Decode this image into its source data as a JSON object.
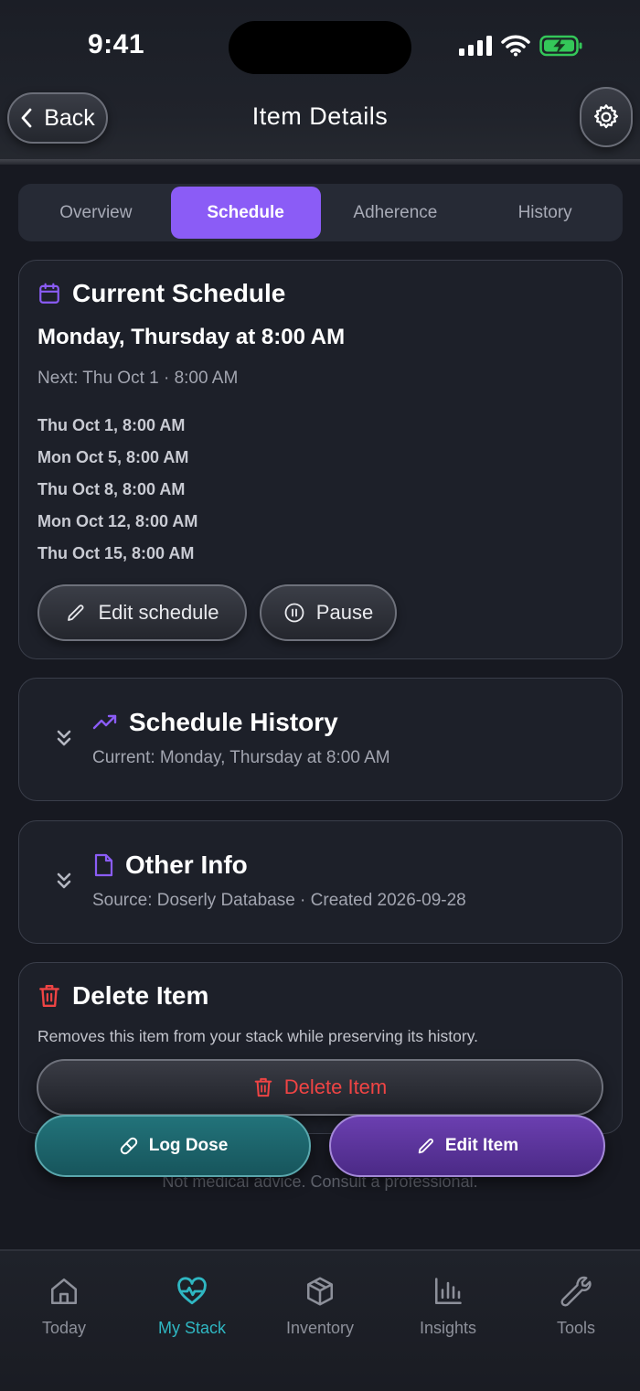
{
  "status_bar": {
    "time": "9:41"
  },
  "header": {
    "back_label": "Back",
    "title": "Item Details"
  },
  "tabs": [
    {
      "label": "Overview",
      "active": false
    },
    {
      "label": "Schedule",
      "active": true
    },
    {
      "label": "Adherence",
      "active": false
    },
    {
      "label": "History",
      "active": false
    }
  ],
  "current_schedule": {
    "title": "Current Schedule",
    "schedule_text": "Monday, Thursday at 8:00 AM",
    "next_text": "Next: Thu Oct 1 · 8:00 AM",
    "upcoming": [
      "Thu Oct 1, 8:00 AM",
      "Mon Oct 5, 8:00 AM",
      "Thu Oct 8, 8:00 AM",
      "Mon Oct 12, 8:00 AM",
      "Thu Oct 15, 8:00 AM"
    ],
    "edit_label": "Edit schedule",
    "pause_label": "Pause"
  },
  "schedule_history": {
    "title": "Schedule History",
    "subtitle": "Current: Monday, Thursday at 8:00 AM"
  },
  "other_info": {
    "title": "Other Info",
    "subtitle": "Source: Doserly Database · Created 2026-09-28"
  },
  "delete_item": {
    "title": "Delete Item",
    "description": "Removes this item from your stack while preserving its history.",
    "button_label": "Delete Item"
  },
  "actions": {
    "log_label": "Log Dose",
    "edit_label": "Edit Item"
  },
  "disclaimer": "Not medical advice. Consult a professional.",
  "bottom_nav": [
    {
      "label": "Today",
      "icon": "home-icon",
      "active": false
    },
    {
      "label": "My Stack",
      "icon": "heart-pulse-icon",
      "active": true
    },
    {
      "label": "Inventory",
      "icon": "box-icon",
      "active": false
    },
    {
      "label": "Insights",
      "icon": "bar-chart-icon",
      "active": false
    },
    {
      "label": "Tools",
      "icon": "wrench-icon",
      "active": false
    }
  ],
  "colors": {
    "accent_purple": "#8b5cf6",
    "accent_teal": "#2fb7c2",
    "danger": "#ef4444",
    "battery_green": "#34c759"
  }
}
